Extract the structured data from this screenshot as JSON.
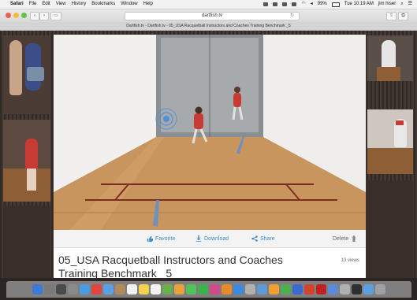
{
  "menubar": {
    "app_name": "Safari",
    "items": [
      "File",
      "Edit",
      "View",
      "History",
      "Bookmarks",
      "Window",
      "Help"
    ],
    "battery": "99%",
    "clock": "Tue 10:19 AM",
    "user": "jim hiser"
  },
  "browser": {
    "url": "dartfish.tv",
    "tab_title": "Dartfish.tv - Dartfish.tv - 05_USA Racquetball Instructors and Coaches Training Benchmark _5"
  },
  "video_actions": {
    "favorite": "Favorite",
    "download": "Download",
    "share": "Share",
    "delete": "Delete"
  },
  "video_info": {
    "title_line1": "05_USA Racquetball Instructors and Coaches",
    "title_line2": "Training Benchmark _5",
    "views": "13 views"
  },
  "colors": {
    "accent": "#3a8ec9",
    "floor": "#c9955e",
    "wall": "#ececea",
    "player_shirt": "#c83a34"
  },
  "dock_icons": [
    "finder-icon",
    "launchpad-icon",
    "mission-control-icon",
    "system-preferences-icon",
    "safari-icon",
    "chrome-icon",
    "mail-icon",
    "contacts-icon",
    "calendar-icon",
    "notes-icon",
    "reminders-icon",
    "maps-icon",
    "photos-icon",
    "messages-icon",
    "facetime-icon",
    "itunes-icon",
    "ibooks-icon",
    "app-store-icon",
    "help-icon",
    "preview-icon",
    "pages-icon",
    "numbers-icon",
    "keynote-icon",
    "powerpoint-icon",
    "acrobat-icon",
    "finder-folder-icon",
    "help-icon-2",
    "movie-icon",
    "downloads-icon",
    "trash-icon"
  ]
}
